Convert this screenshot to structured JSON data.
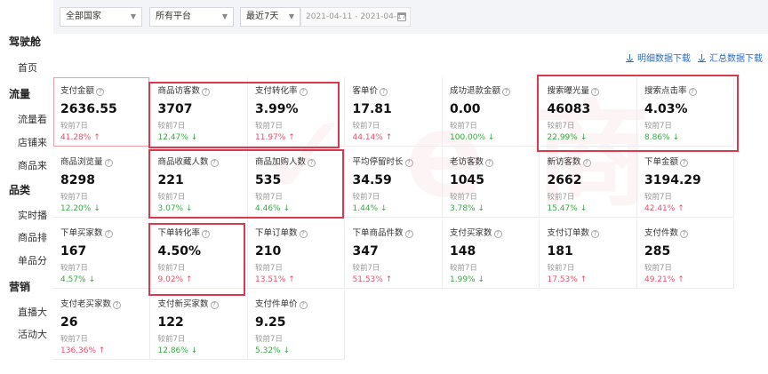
{
  "filters": {
    "country": "全部国家",
    "platform": "所有平台",
    "period": "最近7天",
    "date_range": "2021-04-11 - 2021-04-17"
  },
  "sidebar": {
    "sections": [
      {
        "title": "驾驶舱",
        "items": [
          "首页"
        ]
      },
      {
        "title": "流量",
        "items": [
          "流量看",
          "店铺来",
          "商品来"
        ]
      },
      {
        "title": "品类",
        "items": [
          "实时播",
          "商品排",
          "单品分"
        ]
      },
      {
        "title": "营销",
        "items": [
          "直播大",
          "活动大"
        ]
      }
    ]
  },
  "downloads": {
    "detail": "明细数据下载",
    "summary": "汇总数据下载"
  },
  "compare_label": "较前7日",
  "colors": {
    "up": "#e8506a",
    "down": "#39a845",
    "highlight": "#d93a4e",
    "link": "#2d6cc0"
  },
  "metrics": [
    {
      "label": "支付金额",
      "value": "2636.55",
      "change": "41.28%",
      "dir": "up"
    },
    {
      "label": "商品访客数",
      "value": "3707",
      "change": "12.47%",
      "dir": "down"
    },
    {
      "label": "支付转化率",
      "value": "3.99%",
      "change": "11.97%",
      "dir": "up"
    },
    {
      "label": "客单价",
      "value": "17.81",
      "change": "44.14%",
      "dir": "up"
    },
    {
      "label": "成功退款金额",
      "value": "0.00",
      "change": "100.00%",
      "dir": "down"
    },
    {
      "label": "搜索曝光量",
      "value": "46083",
      "change": "22.99%",
      "dir": "down"
    },
    {
      "label": "搜索点击率",
      "value": "4.03%",
      "change": "8.86%",
      "dir": "down"
    },
    {
      "label": "商品浏览量",
      "value": "8298",
      "change": "12.20%",
      "dir": "down"
    },
    {
      "label": "商品收藏人数",
      "value": "221",
      "change": "3.07%",
      "dir": "down"
    },
    {
      "label": "商品加购人数",
      "value": "535",
      "change": "4.46%",
      "dir": "down"
    },
    {
      "label": "平均停留时长",
      "value": "34.59",
      "change": "1.44%",
      "dir": "down"
    },
    {
      "label": "老访客数",
      "value": "1045",
      "change": "3.78%",
      "dir": "down"
    },
    {
      "label": "新访客数",
      "value": "2662",
      "change": "15.47%",
      "dir": "down"
    },
    {
      "label": "下单金额",
      "value": "3194.29",
      "change": "42.41%",
      "dir": "up"
    },
    {
      "label": "下单买家数",
      "value": "167",
      "change": "4.57%",
      "dir": "down"
    },
    {
      "label": "下单转化率",
      "value": "4.50%",
      "change": "9.02%",
      "dir": "up"
    },
    {
      "label": "下单订单数",
      "value": "210",
      "change": "13.51%",
      "dir": "up"
    },
    {
      "label": "下单商品件数",
      "value": "347",
      "change": "51.53%",
      "dir": "up"
    },
    {
      "label": "支付买家数",
      "value": "148",
      "change": "1.99%",
      "dir": "down"
    },
    {
      "label": "支付订单数",
      "value": "181",
      "change": "17.53%",
      "dir": "up"
    },
    {
      "label": "支付件数",
      "value": "285",
      "change": "49.21%",
      "dir": "up"
    },
    {
      "label": "支付老买家数",
      "value": "26",
      "change": "136.36%",
      "dir": "up"
    },
    {
      "label": "支付新买家数",
      "value": "122",
      "change": "12.86%",
      "dir": "down"
    },
    {
      "label": "支付件单价",
      "value": "9.25",
      "change": "5.32%",
      "dir": "down"
    }
  ]
}
